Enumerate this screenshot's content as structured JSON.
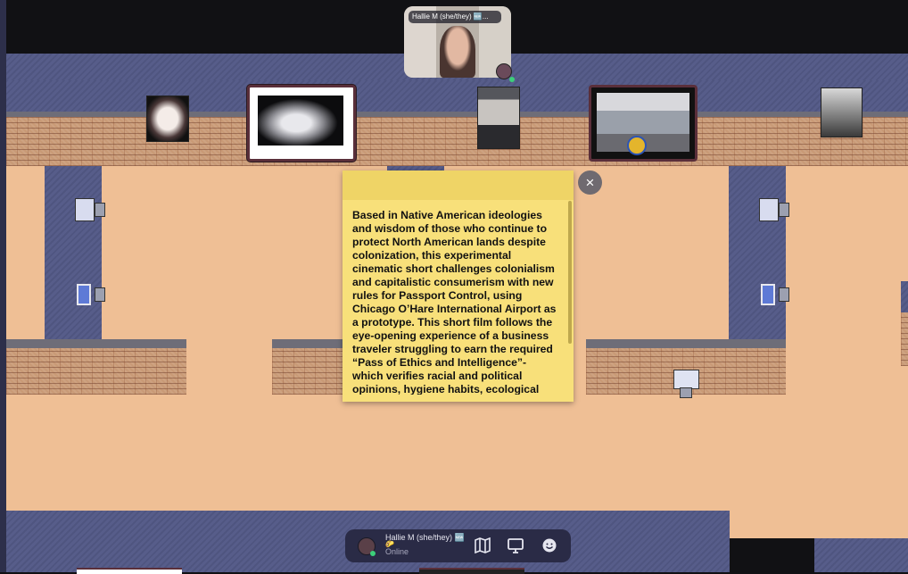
{
  "video_tile": {
    "name": "Hallie M (she/they) 🆕..."
  },
  "note": {
    "text": "Based in Native American ideologies and wisdom of those who continue to protect North American lands despite colonization, this experimental cinematic short challenges colonialism and capitalistic consumerism with new rules for Passport Control, using Chicago O’Hare International Airport as a prototype. This short film follows the eye-opening experience of a business traveler struggling to earn the required “Pass of Ethics and Intelligence”- which verifies racial and political opinions, hygiene habits, ecological habits, and more. Through out the",
    "close_label": "×"
  },
  "bottom_bar": {
    "user_name": "Hallie M (she/they) 🆕",
    "status": "Online",
    "sub_emoji": "🌮"
  },
  "colors": {
    "floor": "#efbf95",
    "wall": "#575d8a",
    "note": "#f8e07a",
    "bar": "#2a2b46",
    "online": "#3ccf7a"
  }
}
